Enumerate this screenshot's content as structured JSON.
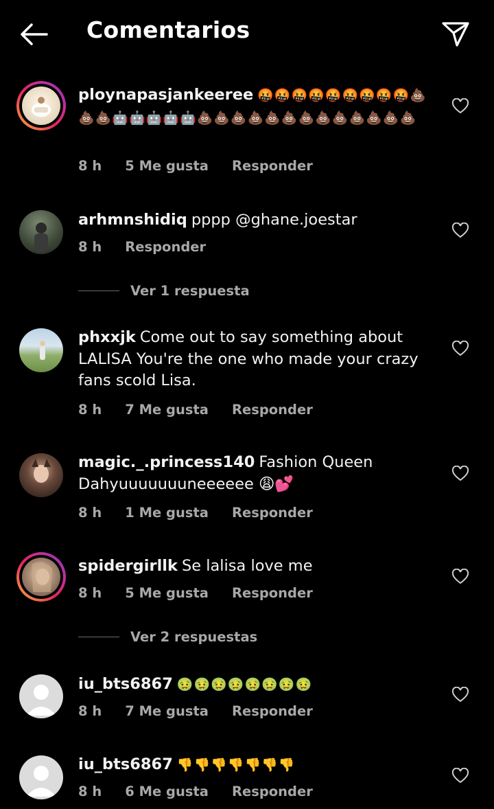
{
  "header": {
    "title": "Comentarios",
    "back_icon": "arrow-left-icon",
    "send_icon": "send-icon"
  },
  "comments": [
    {
      "username": "ploynapasjankeeree",
      "text": "🤬🤬🤬🤬🤬🤬🤬🤬🤬💩💩💩🤖🤖🤖🤖🤖💩💩💩💩💩💩💩💩💩💩💩💩💩",
      "time": "8 h",
      "likes": "5 Me gusta",
      "reply": "Responder",
      "story_ring": true
    },
    {
      "username": "arhmnshidiq",
      "text": "pppp @ghane.joestar",
      "time": "8 h",
      "likes": "",
      "reply": "Responder",
      "story_ring": false,
      "view_replies": "Ver 1 respuesta"
    },
    {
      "username": "phxxjk",
      "text": "Come out to say something about LALISA You're the one who made your crazy fans scold Lisa.",
      "time": "8 h",
      "likes": "7 Me gusta",
      "reply": "Responder",
      "story_ring": false
    },
    {
      "username": "magic._.princess140",
      "text": "Fashion Queen Dahyuuuuuuuneeeeee 😩💕",
      "time": "8 h",
      "likes": "1 Me gusta",
      "reply": "Responder",
      "story_ring": false
    },
    {
      "username": "spidergirllk",
      "text": "Se lalisa love me",
      "time": "8 h",
      "likes": "5 Me gusta",
      "reply": "Responder",
      "story_ring": true,
      "view_replies": "Ver 2 respuestas"
    },
    {
      "username": "iu_bts6867",
      "text": "🤢🤢🤢🤢🤢🤢🤢🤢",
      "time": "8 h",
      "likes": "7 Me gusta",
      "reply": "Responder",
      "story_ring": false
    },
    {
      "username": "iu_bts6867",
      "text": "👎👎👎👎👎👎👎",
      "time": "8 h",
      "likes": "6 Me gusta",
      "reply": "Responder",
      "story_ring": false
    }
  ],
  "colors": {
    "background": "#000000",
    "text": "#f2f2f2",
    "secondary": "#a8a8a8",
    "ring_gradient": [
      "#f9b33b",
      "#e3245b",
      "#c82e96",
      "#8d36c4"
    ]
  }
}
